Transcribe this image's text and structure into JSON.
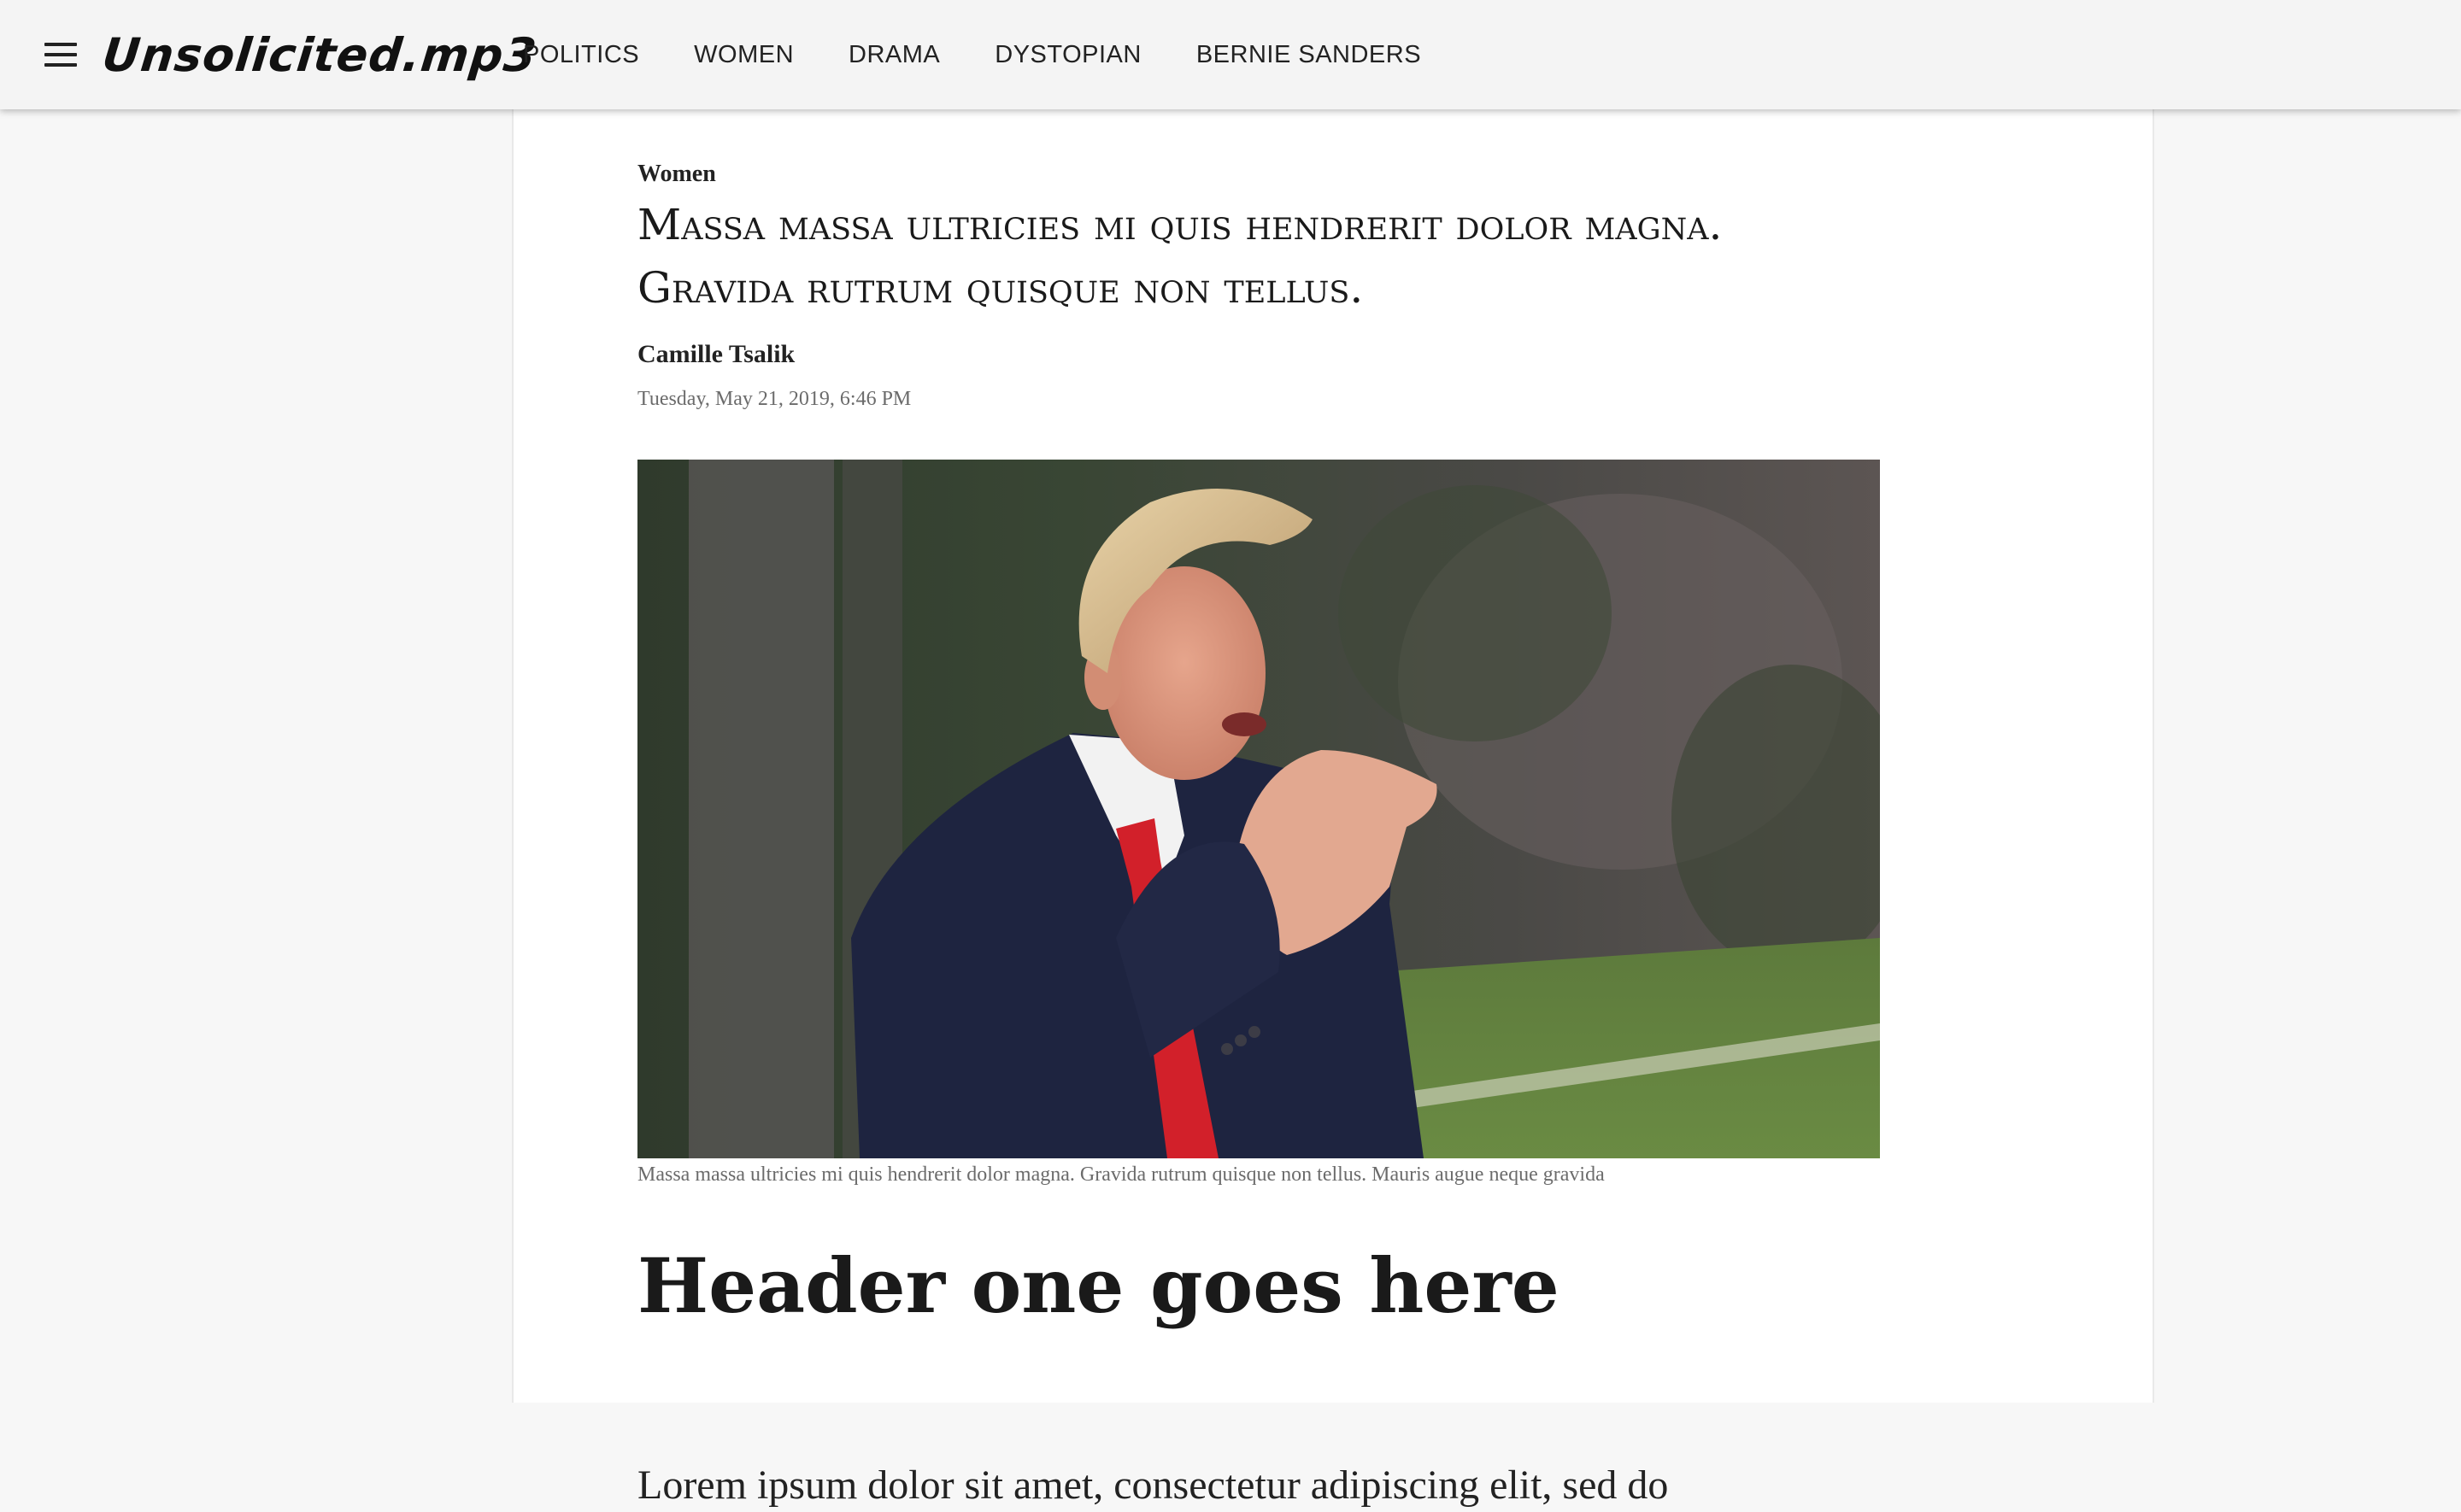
{
  "header": {
    "logo_text": "Unsolicited.mp3",
    "menu_icon": "hamburger-menu-icon",
    "nav": [
      {
        "label": "POLITICS"
      },
      {
        "label": "WOMEN"
      },
      {
        "label": "DRAMA"
      },
      {
        "label": "DYSTOPIAN"
      },
      {
        "label": "BERNIE SANDERS"
      }
    ]
  },
  "article": {
    "category": "Women",
    "headline": "Massa massa ultricies mi quis hendrerit dolor magna. Gravida rutrum quisque non tellus.",
    "author": "Camille Tsalik",
    "date": "Tuesday, May 21, 2019, 6:46 PM",
    "hero_image": {
      "caption": "Massa massa ultricies mi quis hendrerit dolor magna. Gravida rutrum quisque non tellus. Mauris augue neque gravida"
    },
    "section_heading": "Header one goes here",
    "body_first_line": "Lorem ipsum dolor sit amet, consectetur adipiscing elit, sed do"
  }
}
